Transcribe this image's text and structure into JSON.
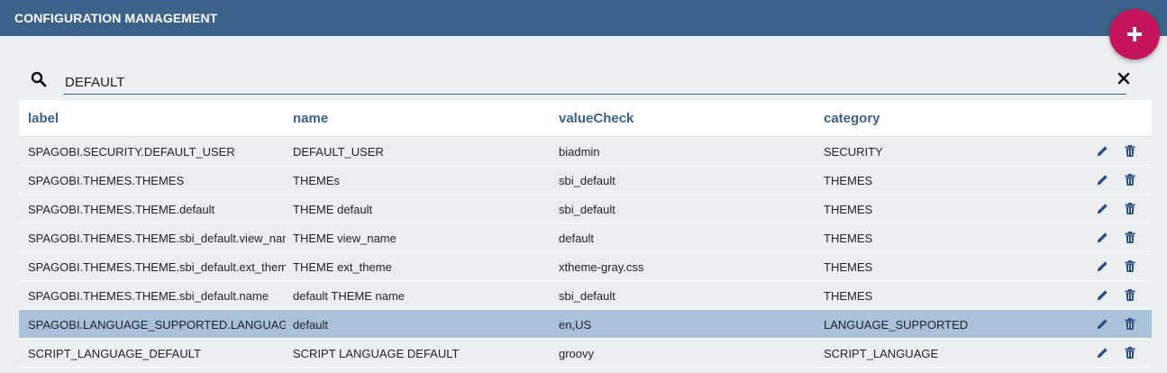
{
  "header": {
    "title": "CONFIGURATION MANAGEMENT"
  },
  "fab": {
    "icon": "plus-icon",
    "color": "#c4145a"
  },
  "search": {
    "value": "DEFAULT",
    "search_icon": "search-icon",
    "clear_icon": "close-icon"
  },
  "table": {
    "columns": [
      "label",
      "name",
      "valueCheck",
      "category"
    ],
    "rows": [
      {
        "label": "SPAGOBI.SECURITY.DEFAULT_USER",
        "name": "DEFAULT_USER",
        "valueCheck": "biadmin",
        "category": "SECURITY"
      },
      {
        "label": "SPAGOBI.THEMES.THEMES",
        "name": "THEMEs",
        "valueCheck": "sbi_default",
        "category": "THEMES"
      },
      {
        "label": "SPAGOBI.THEMES.THEME.default",
        "name": "THEME default",
        "valueCheck": "sbi_default",
        "category": "THEMES"
      },
      {
        "label": "SPAGOBI.THEMES.THEME.sbi_default.view_name",
        "name": "THEME view_name",
        "valueCheck": "default",
        "category": "THEMES"
      },
      {
        "label": "SPAGOBI.THEMES.THEME.sbi_default.ext_theme",
        "name": "THEME ext_theme",
        "valueCheck": "xtheme-gray.css",
        "category": "THEMES"
      },
      {
        "label": "SPAGOBI.THEMES.THEME.sbi_default.name",
        "name": "default THEME name",
        "valueCheck": "sbi_default",
        "category": "THEMES"
      },
      {
        "label": "SPAGOBI.LANGUAGE_SUPPORTED.LANGUAGE.default",
        "name": "default",
        "valueCheck": "en,US",
        "category": "LANGUAGE_SUPPORTED"
      },
      {
        "label": "SCRIPT_LANGUAGE_DEFAULT",
        "name": "SCRIPT LANGUAGE DEFAULT",
        "valueCheck": "groovy",
        "category": "SCRIPT_LANGUAGE"
      }
    ],
    "selected_row": 6,
    "row_actions": [
      "pencil-icon",
      "trash-icon"
    ]
  },
  "colors": {
    "header": "#3b6389",
    "accent": "#3b6389",
    "selected_row": "#a9c2d9",
    "background": "#eceff2"
  }
}
